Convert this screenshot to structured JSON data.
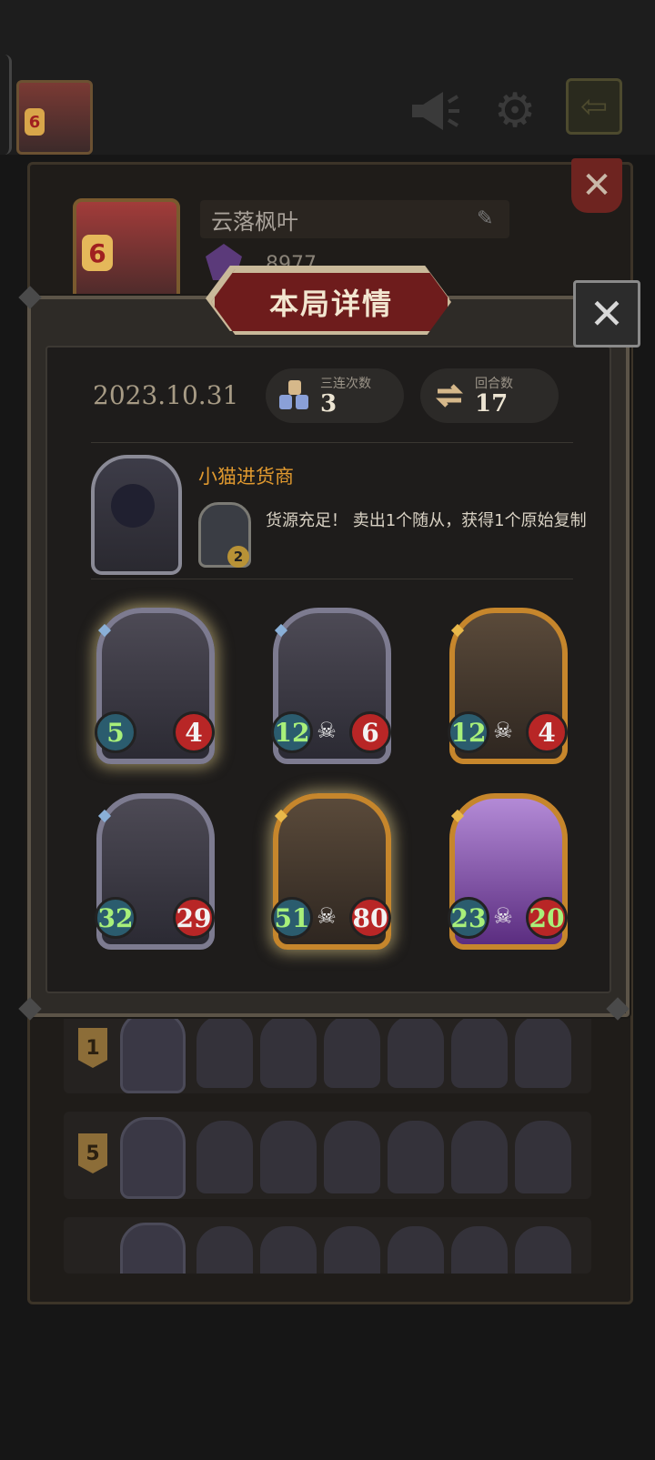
{
  "top_bar": {
    "avatar_level": "6",
    "icons": [
      "megaphone-icon",
      "gear-icon",
      "back-arrow-icon"
    ]
  },
  "profile": {
    "level": "6",
    "name": "云落枫叶",
    "score": "8977"
  },
  "panel": {
    "title": "本局详情",
    "date": "2023.10.31",
    "triples_label": "三连次数",
    "triples_value": "3",
    "turns_label": "回合数",
    "turns_value": "17"
  },
  "hero": {
    "name": "小猫进货商",
    "power_cost": "2",
    "power_text": "货源充足！ 卖出1个随从，获得1个原始复制"
  },
  "minions": [
    {
      "attack": "5",
      "health": "4",
      "frame": "silver",
      "health_style": "red",
      "skull": false,
      "glow": true
    },
    {
      "attack": "12",
      "health": "6",
      "frame": "silver",
      "health_style": "red",
      "skull": true,
      "glow": false
    },
    {
      "attack": "12",
      "health": "4",
      "frame": "gold",
      "health_style": "red",
      "skull": true,
      "glow": false
    },
    {
      "attack": "32",
      "health": "29",
      "frame": "silver",
      "health_style": "red",
      "skull": false,
      "glow": false
    },
    {
      "attack": "51",
      "health": "80",
      "frame": "gold",
      "health_style": "red",
      "skull": true,
      "glow": true
    },
    {
      "attack": "23",
      "health": "20",
      "frame": "gold",
      "health_style": "green",
      "skull": true,
      "glow": false
    }
  ],
  "history": [
    {
      "rank": "1"
    },
    {
      "rank": "5"
    }
  ],
  "colors": {
    "accent_orange": "#e0992f",
    "banner_red": "#6e1c1c",
    "attack_teal": "#2b5c6e",
    "health_red": "#b82626"
  }
}
